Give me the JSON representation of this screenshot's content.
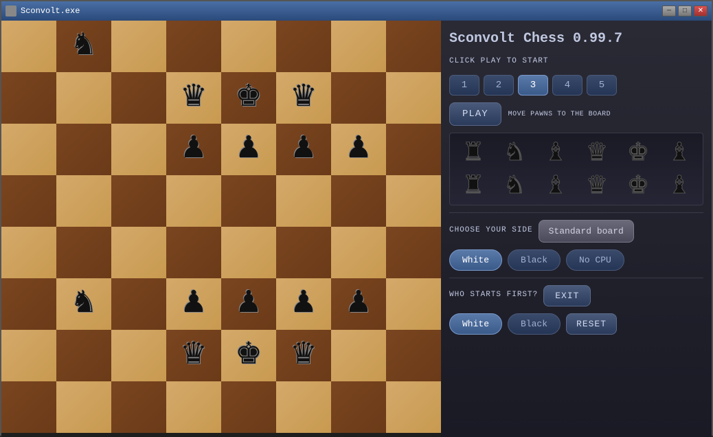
{
  "window": {
    "title": "Sconvolt.exe"
  },
  "app": {
    "title": "Sconvolt Chess 0.99.7",
    "click_to_start": "CLICK PLAY TO START",
    "play_button": "PLAY",
    "move_hint": "MOVE PAWNS TO THE BOARD",
    "choose_side_label": "CHOOSE YOUR SIDE",
    "who_starts_label": "WHO STARTS FIRST?",
    "standard_board_label": "Standard board",
    "exit_label": "EXIT",
    "reset_label": "RESET"
  },
  "difficulty": {
    "levels": [
      "1",
      "2",
      "3",
      "4",
      "5"
    ],
    "active": 2
  },
  "side_buttons": {
    "white_label": "White",
    "black_label": "Black",
    "no_cpu_label": "No CPU",
    "white_active": true
  },
  "starts_buttons": {
    "white_label": "White",
    "black_label": "Black",
    "white_active": true
  },
  "board": {
    "pieces": [
      [
        "",
        "♞",
        "",
        "",
        "",
        "",
        "",
        ""
      ],
      [
        "",
        "",
        "",
        "♛",
        "♚",
        "♛",
        "",
        ""
      ],
      [
        "",
        "",
        "",
        "♟",
        "♟",
        "♟",
        "♟",
        ""
      ],
      [
        "",
        "",
        "",
        "",
        "",
        "",
        "",
        ""
      ],
      [
        "",
        "",
        "",
        "",
        "",
        "",
        "",
        ""
      ],
      [
        "",
        "♞",
        "",
        "♟",
        "♟",
        "♟",
        "♟",
        ""
      ],
      [
        "",
        "",
        "",
        "♛",
        "♚",
        "♛",
        "",
        ""
      ],
      [
        "",
        "",
        "",
        "",
        "",
        "",
        "",
        ""
      ]
    ]
  },
  "tray": {
    "row1": [
      "♜",
      "♞",
      "♝",
      "♛",
      "♚",
      "♝"
    ],
    "row2": [
      "♜",
      "♞",
      "♝",
      "♛",
      "♚",
      "♝"
    ]
  }
}
